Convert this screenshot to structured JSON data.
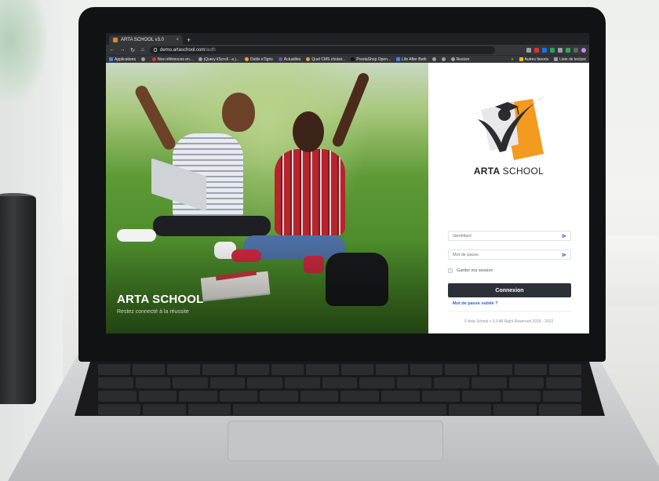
{
  "browser": {
    "tab_title": "ARTA SCHOOL v3.0",
    "tab_close": "×",
    "new_tab": "+",
    "url_host": "demo.artaschool.com",
    "url_path": "/auth",
    "nav": {
      "back": "←",
      "forward": "→",
      "reload": "↻",
      "home": "⌂"
    }
  },
  "bookmarks": {
    "items": [
      {
        "label": "Applications",
        "icon": "apps-icon"
      },
      {
        "label": "",
        "icon": "globe-icon"
      },
      {
        "label": "Nos références en...",
        "icon": "bookmark-icon"
      },
      {
        "label": "jQuery liScroll - a j...",
        "icon": "globe-icon"
      },
      {
        "label": "Outils eTigris",
        "icon": "bookmark-icon"
      },
      {
        "label": "Actualités",
        "icon": "bookmark-icon"
      },
      {
        "label": "Quel CMS choisir...",
        "icon": "bookmark-icon"
      },
      {
        "label": "PrestaShop Open...",
        "icon": "bookmark-icon"
      },
      {
        "label": "Life After Beth",
        "icon": "bookmark-icon"
      },
      {
        "label": "",
        "icon": "globe-icon"
      },
      {
        "label": "",
        "icon": "globe-icon"
      },
      {
        "label": "Resizer",
        "icon": "bookmark-icon"
      }
    ],
    "more": "»",
    "other_favorites": "Autres favoris",
    "reading_list": "Liste de lecture"
  },
  "hero": {
    "title": "ARTA SCHOOL",
    "subtitle": "Restez connecté à la réussite"
  },
  "login": {
    "logo_text_bold": "ARTA",
    "logo_text_light": "SCHOOL",
    "username_placeholder": "Identifiant",
    "password_placeholder": "Mot de passe",
    "remember_label": "Garder ma session",
    "submit_label": "Connexion",
    "forgot_label": "Mot de passe oublié ?",
    "copyright": "© Arta School v 3.0 All Right Reserved 2018 - 2022"
  },
  "colors": {
    "accent_orange": "#f39a1f",
    "button_dark": "#2c3138",
    "link_blue": "#2a61d4"
  }
}
